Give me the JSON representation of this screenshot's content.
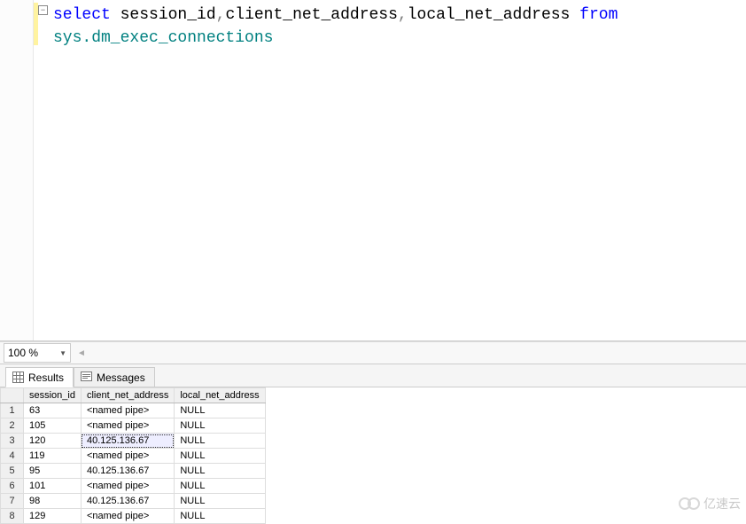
{
  "code": {
    "tokens": [
      {
        "text": "select",
        "cls": "kw"
      },
      {
        "text": " ",
        "cls": "ident"
      },
      {
        "text": "session_id",
        "cls": "ident"
      },
      {
        "text": ",",
        "cls": "punct"
      },
      {
        "text": "client_net_address",
        "cls": "ident"
      },
      {
        "text": ",",
        "cls": "punct"
      },
      {
        "text": "local_net_address",
        "cls": "ident"
      },
      {
        "text": " ",
        "cls": "ident"
      },
      {
        "text": "from",
        "cls": "kw"
      },
      {
        "text": "\n",
        "cls": ""
      },
      {
        "text": "sys.dm_exec_connections",
        "cls": "obj"
      }
    ],
    "fold_symbol": "−"
  },
  "zoom": {
    "value": "100 %"
  },
  "tabs": {
    "results": "Results",
    "messages": "Messages"
  },
  "grid": {
    "columns": [
      "session_id",
      "client_net_address",
      "local_net_address"
    ],
    "rows": [
      {
        "n": "1",
        "c": [
          "63",
          "<named pipe>",
          "NULL"
        ]
      },
      {
        "n": "2",
        "c": [
          "105",
          "<named pipe>",
          "NULL"
        ]
      },
      {
        "n": "3",
        "c": [
          "120",
          "40.125.136.67",
          "NULL"
        ]
      },
      {
        "n": "4",
        "c": [
          "119",
          "<named pipe>",
          "NULL"
        ]
      },
      {
        "n": "5",
        "c": [
          "95",
          "40.125.136.67",
          "NULL"
        ]
      },
      {
        "n": "6",
        "c": [
          "101",
          "<named pipe>",
          "NULL"
        ]
      },
      {
        "n": "7",
        "c": [
          "98",
          "40.125.136.67",
          "NULL"
        ]
      },
      {
        "n": "8",
        "c": [
          "129",
          "<named pipe>",
          "NULL"
        ]
      }
    ],
    "selected": {
      "row": 2,
      "col": 1
    }
  },
  "watermark": {
    "text": "亿速云"
  }
}
